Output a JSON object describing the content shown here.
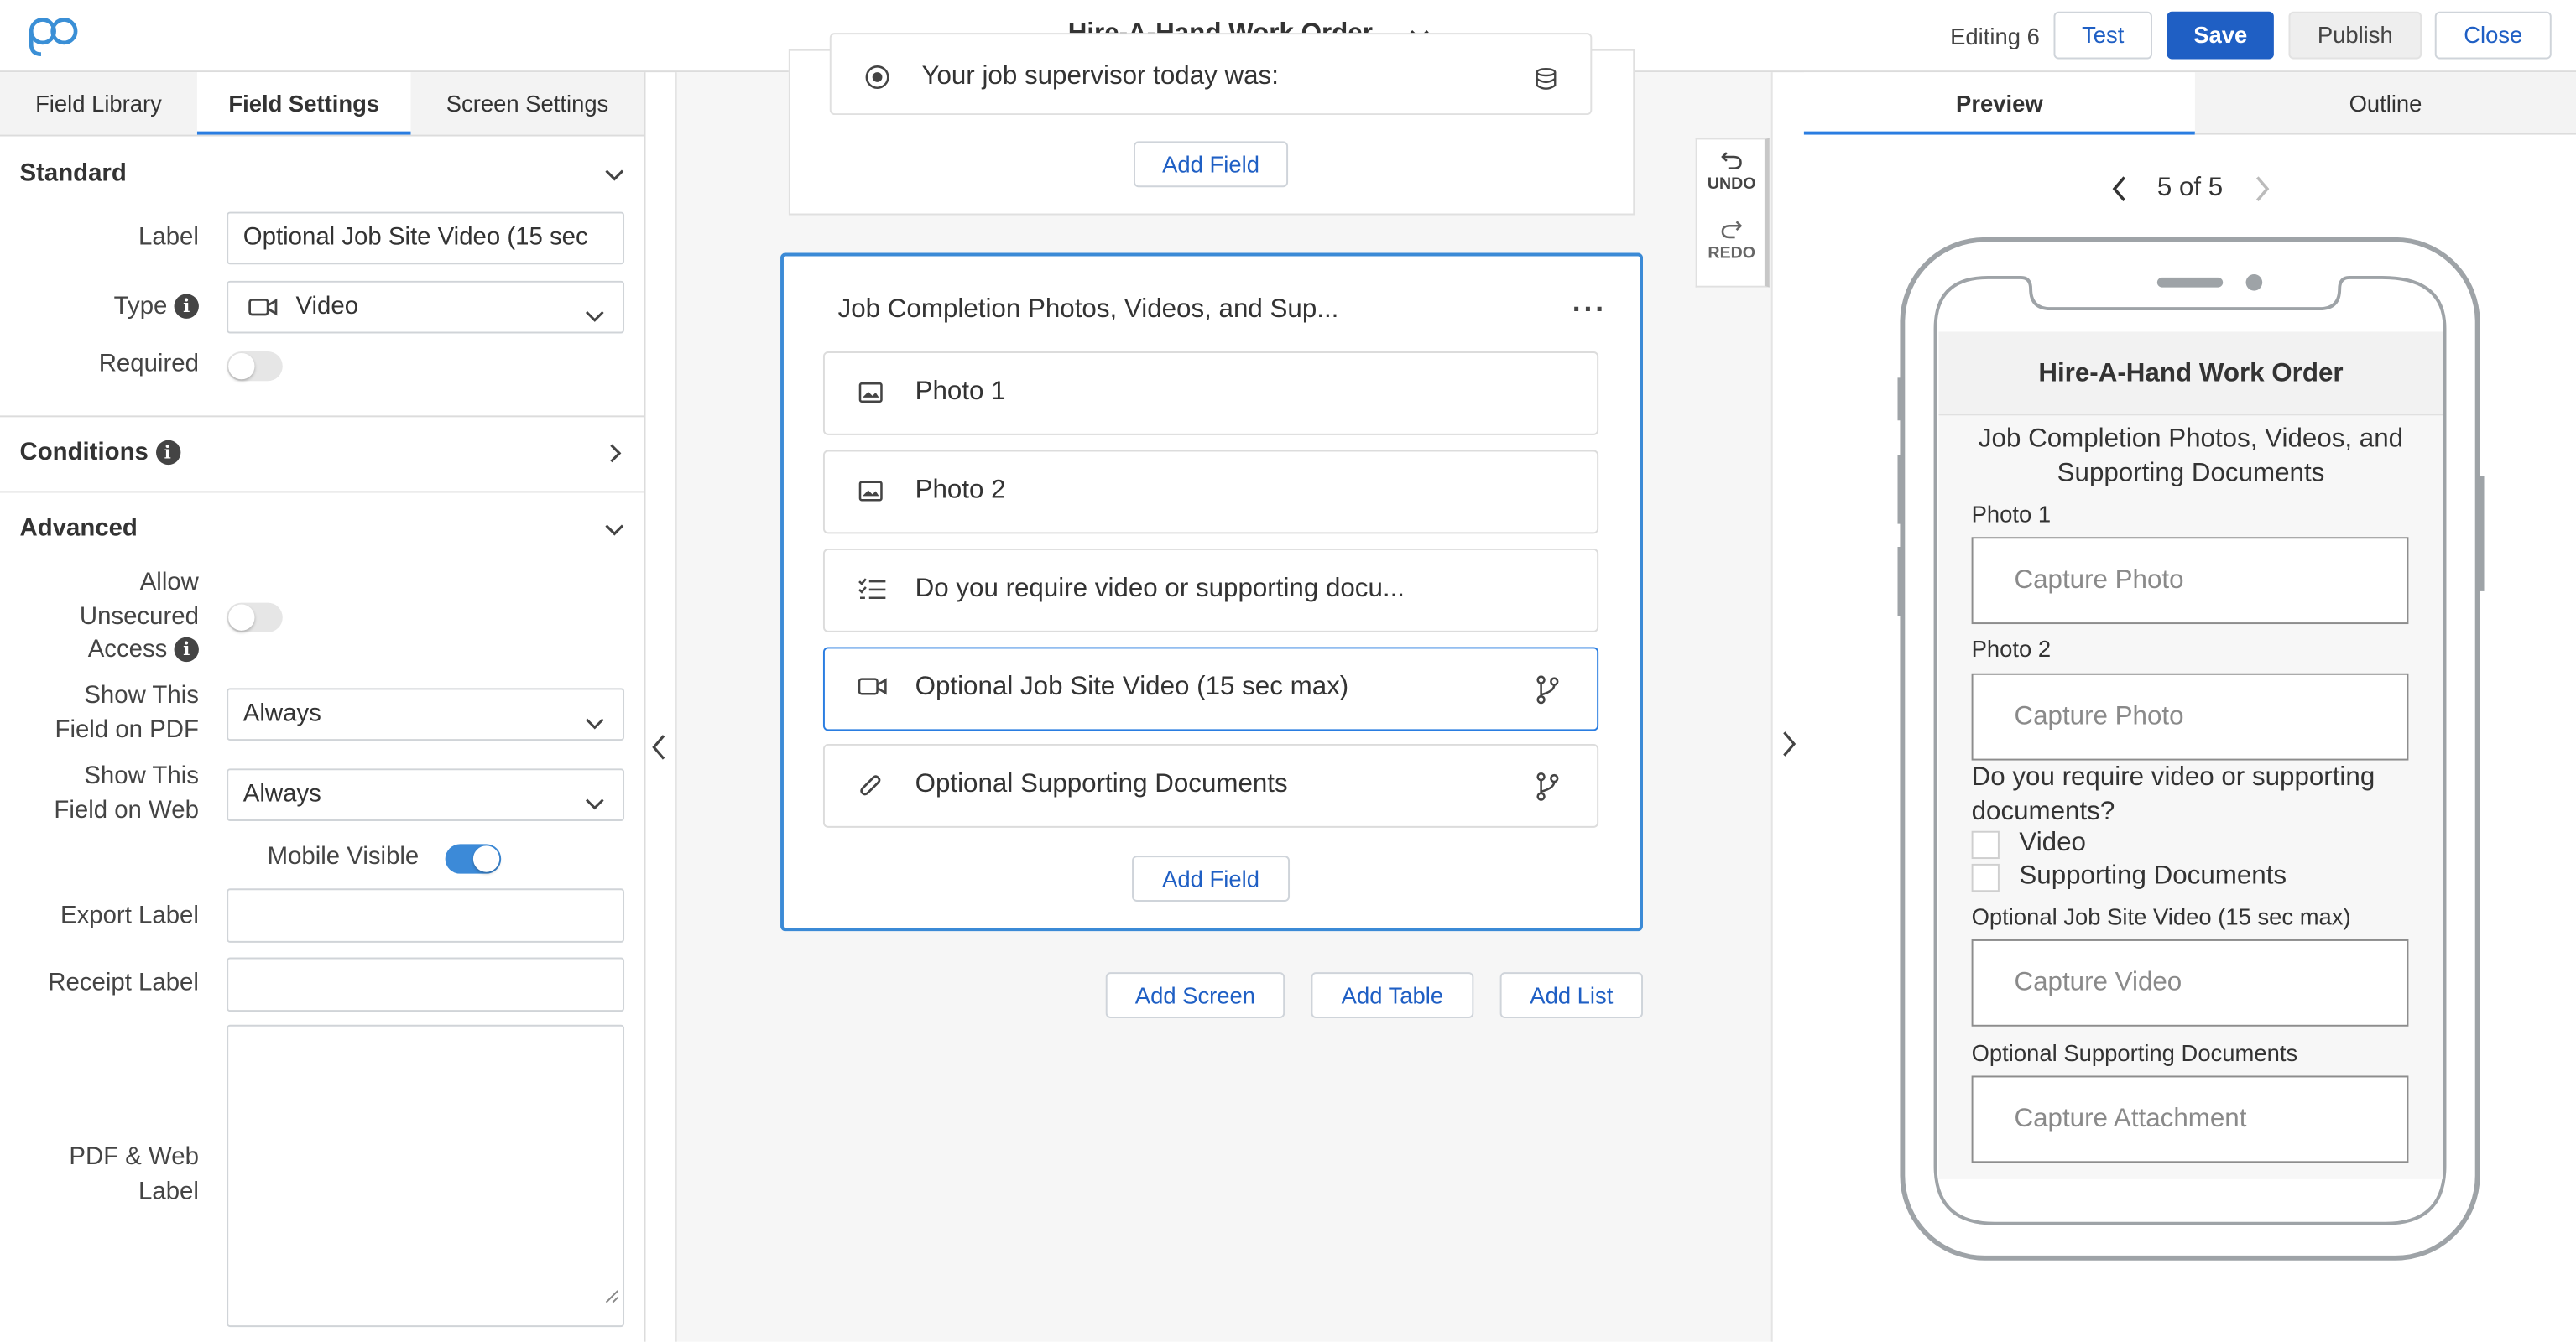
{
  "header": {
    "app_title": "Hire-A-Hand Work Order",
    "editing": "Editing 6",
    "test": "Test",
    "save": "Save",
    "publish": "Publish",
    "close": "Close"
  },
  "left_tabs": [
    "Field Library",
    "Field Settings",
    "Screen Settings"
  ],
  "standard": {
    "title": "Standard",
    "label_label": "Label",
    "label_value": "Optional Job Site Video (15 sec",
    "type_label": "Type",
    "type_value": "Video",
    "required_label": "Required"
  },
  "conditions": {
    "title": "Conditions"
  },
  "advanced": {
    "title": "Advanced",
    "unsecured_line1": "Allow",
    "unsecured_line2": "Unsecured",
    "unsecured_line3": "Access",
    "pdf_line1": "Show This",
    "pdf_line2": "Field on PDF",
    "pdf_value": "Always",
    "web_line1": "Show This",
    "web_line2": "Field on Web",
    "web_value": "Always",
    "mobile_visible": "Mobile Visible",
    "export_label": "Export Label",
    "receipt_label": "Receipt Label",
    "pdfweb_line1": "PDF & Web",
    "pdfweb_line2": "Label"
  },
  "canvas": {
    "prev_field": "Your job supervisor today was:",
    "add_field": "Add Field",
    "screen_title": "Job Completion Photos, Videos, and Sup...",
    "fields": [
      "Photo 1",
      "Photo 2",
      "Do you require video or supporting docu...",
      "Optional Job Site Video (15 sec max)",
      "Optional Supporting Documents"
    ],
    "add_field_2": "Add Field",
    "add_screen": "Add Screen",
    "add_table": "Add Table",
    "add_list": "Add List",
    "undo": "UNDO",
    "redo": "REDO"
  },
  "right_tabs": [
    "Preview",
    "Outline"
  ],
  "preview": {
    "pager": "5 of 5",
    "app_title": "Hire-A-Hand Work Order",
    "screen_title_1": "Job Completion Photos, Videos, and",
    "screen_title_2": "Supporting Documents",
    "photo1_label": "Photo 1",
    "photo1_placeholder": "Capture Photo",
    "photo2_label": "Photo 2",
    "photo2_placeholder": "Capture Photo",
    "question_1": "Do you require video or supporting",
    "question_2": "documents?",
    "option_video": "Video",
    "option_docs": "Supporting Documents",
    "video_label": "Optional Job Site Video (15 sec max)",
    "video_placeholder": "Capture Video",
    "docs_label": "Optional Supporting Documents",
    "docs_placeholder": "Capture Attachment"
  }
}
